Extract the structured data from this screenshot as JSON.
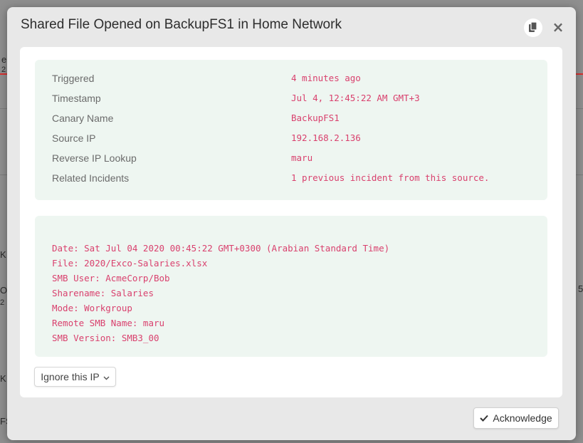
{
  "background": {
    "fragments": [
      "e",
      "2",
      "K",
      "Op",
      "2",
      "5",
      "K",
      "FS"
    ]
  },
  "modal": {
    "title": "Shared File Opened on BackupFS1 in Home Network",
    "copy_icon": "copy-icon",
    "close_label": "×"
  },
  "details": [
    {
      "label": "Triggered",
      "value": "4 minutes ago"
    },
    {
      "label": "Timestamp",
      "value": "Jul 4, 12:45:22 AM GMT+3"
    },
    {
      "label": "Canary Name",
      "value": "BackupFS1"
    },
    {
      "label": "Source IP",
      "value": "192.168.2.136"
    },
    {
      "label": "Reverse IP Lookup",
      "value": "maru"
    },
    {
      "label": "Related Incidents",
      "value": "1 previous incident from this source."
    }
  ],
  "log": [
    "Date: Sat Jul 04 2020 00:45:22 GMT+0300 (Arabian Standard Time)",
    "File: 2020/Exco-Salaries.xlsx",
    "SMB User: AcmeCorp/Bob",
    "Sharename: Salaries",
    "Mode: Workgroup",
    "Remote SMB Name: maru",
    "SMB Version: SMB3_00"
  ],
  "actions": {
    "ignore_label": "Ignore this IP",
    "acknowledge_label": "Acknowledge"
  },
  "colors": {
    "accent": "#d9416e",
    "panel_bg": "#eef6f1",
    "label_text": "#6b6b6b"
  }
}
